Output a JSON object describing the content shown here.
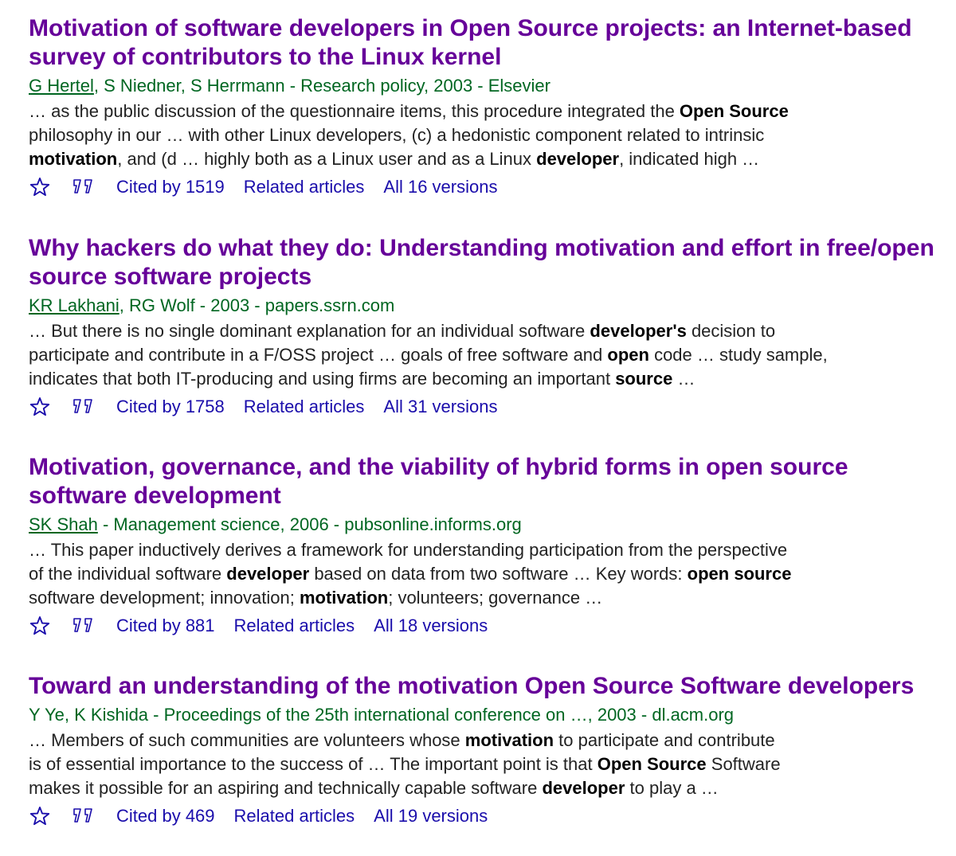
{
  "results": [
    {
      "title_lines": [
        [
          {
            "text": "Motivation",
            "b": true
          },
          {
            "text": " of software developers in ",
            "b": false
          },
          {
            "text": "Open Source",
            "b": true
          },
          {
            "text": " projects: an Internet-based",
            "b": false
          }
        ],
        [
          {
            "text": "survey of contributors to the Linux kernel",
            "b": false
          }
        ]
      ],
      "authors": [
        {
          "text": "G Hertel",
          "link": true
        },
        {
          "text": ", S Niedner, S Herrmann - Research policy, 2003 - Elsevier",
          "link": false
        }
      ],
      "snippet_lines": [
        [
          {
            "text": "… as the public discussion of the questionnaire items, this procedure integrated the ",
            "b": false
          },
          {
            "text": "Open Source",
            "b": true
          }
        ],
        [
          {
            "text": "philosophy in our … with other Linux developers, (c) a hedonistic component related to intrinsic",
            "b": false
          }
        ],
        [
          {
            "text": "motivation",
            "b": true
          },
          {
            "text": ", and (d … highly both as a Linux user and as a Linux ",
            "b": false
          },
          {
            "text": "developer",
            "b": true
          },
          {
            "text": ", indicated high …",
            "b": false
          }
        ]
      ],
      "cited": "Cited by 1519",
      "related": "Related articles",
      "versions": "All 16 versions"
    },
    {
      "title_lines": [
        [
          {
            "text": "Why hackers do what they do: Understanding ",
            "b": false
          },
          {
            "text": "motivation",
            "b": true
          },
          {
            "text": " and effort in free/",
            "b": false
          },
          {
            "text": "open",
            "b": true
          }
        ],
        [
          {
            "text": "source",
            "b": true
          },
          {
            "text": " software projects",
            "b": false
          }
        ]
      ],
      "authors": [
        {
          "text": "KR Lakhani",
          "link": true
        },
        {
          "text": ", RG Wolf - 2003 - papers.ssrn.com",
          "link": false
        }
      ],
      "snippet_lines": [
        [
          {
            "text": "… But there is no single dominant explanation for an individual software ",
            "b": false
          },
          {
            "text": "developer's",
            "b": true
          },
          {
            "text": " decision to",
            "b": false
          }
        ],
        [
          {
            "text": "participate and contribute in a F/OSS project … goals of free software and ",
            "b": false
          },
          {
            "text": "open",
            "b": true
          },
          {
            "text": " code … study sample,",
            "b": false
          }
        ],
        [
          {
            "text": "indicates that both IT-producing and using firms are becoming an important ",
            "b": false
          },
          {
            "text": "source",
            "b": true
          },
          {
            "text": " …",
            "b": false
          }
        ]
      ],
      "cited": "Cited by 1758",
      "related": "Related articles",
      "versions": "All 31 versions"
    },
    {
      "title_lines": [
        [
          {
            "text": "Motivation",
            "b": true
          },
          {
            "text": ", governance, and the viability of hybrid forms in ",
            "b": false
          },
          {
            "text": "open source",
            "b": true
          }
        ],
        [
          {
            "text": "software development",
            "b": false
          }
        ]
      ],
      "authors": [
        {
          "text": "SK Shah",
          "link": true
        },
        {
          "text": " - Management science, 2006 - pubsonline.informs.org",
          "link": false
        }
      ],
      "snippet_lines": [
        [
          {
            "text": "… This paper inductively derives a framework for understanding participation from the perspective",
            "b": false
          }
        ],
        [
          {
            "text": "of the individual software ",
            "b": false
          },
          {
            "text": "developer",
            "b": true
          },
          {
            "text": " based on data from two software … Key words: ",
            "b": false
          },
          {
            "text": "open source",
            "b": true
          }
        ],
        [
          {
            "text": "software development; innovation; ",
            "b": false
          },
          {
            "text": "motivation",
            "b": true
          },
          {
            "text": "; volunteers; governance …",
            "b": false
          }
        ]
      ],
      "cited": "Cited by 881",
      "related": "Related articles",
      "versions": "All 18 versions"
    },
    {
      "title_lines": [
        [
          {
            "text": "Toward an understanding of the ",
            "b": false
          },
          {
            "text": "motivation Open Source",
            "b": true
          },
          {
            "text": " Software developers",
            "b": false
          }
        ]
      ],
      "authors": [
        {
          "text": "Y Ye, K Kishida - Proceedings of the 25th international conference on …, 2003 - dl.acm.org",
          "link": false
        }
      ],
      "snippet_lines": [
        [
          {
            "text": "… Members of such communities are volunteers whose ",
            "b": false
          },
          {
            "text": "motivation",
            "b": true
          },
          {
            "text": " to participate and contribute",
            "b": false
          }
        ],
        [
          {
            "text": "is of essential importance to the success of … The important point is that ",
            "b": false
          },
          {
            "text": "Open Source",
            "b": true
          },
          {
            "text": " Software",
            "b": false
          }
        ],
        [
          {
            "text": "makes it possible for an aspiring and technically capable software ",
            "b": false
          },
          {
            "text": "developer",
            "b": true
          },
          {
            "text": " to play a …",
            "b": false
          }
        ]
      ],
      "cited": "Cited by 469",
      "related": "Related articles",
      "versions": "All 19 versions"
    }
  ],
  "colors": {
    "title": "#660099",
    "authors": "#006621",
    "link": "#1a0dab",
    "snippet": "#222222"
  },
  "icons": {
    "save": "star-icon",
    "cite": "quote-icon"
  }
}
